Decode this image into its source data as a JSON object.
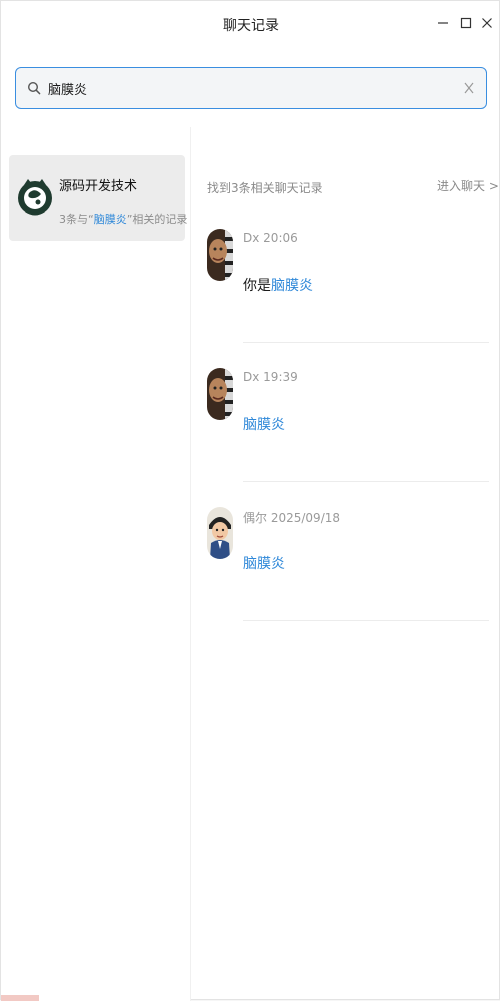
{
  "window": {
    "title": "聊天记录"
  },
  "search": {
    "query": "脑膜炎"
  },
  "left_list": {
    "items": [
      {
        "name": "源码开发技术",
        "sub_prefix": "3条与“",
        "sub_keyword": "脑膜炎",
        "sub_suffix": "”相关的记录"
      }
    ]
  },
  "results": {
    "count_text": "找到3条相关聊天记录",
    "enter_chat_label": "进入聊天 >",
    "messages": [
      {
        "sender": "Dx",
        "time": "20:06",
        "text_prefix": "你是",
        "text_keyword": "脑膜炎"
      },
      {
        "sender": "Dx",
        "time": "19:39",
        "text_prefix": "",
        "text_keyword": "脑膜炎"
      },
      {
        "sender": "偶尔",
        "time": "2025/09/18",
        "text_prefix": "",
        "text_keyword": "脑膜炎"
      }
    ]
  },
  "colors": {
    "accent": "#2d87d8",
    "search_border": "#3a8ee0",
    "selected_bg": "#ececec"
  }
}
